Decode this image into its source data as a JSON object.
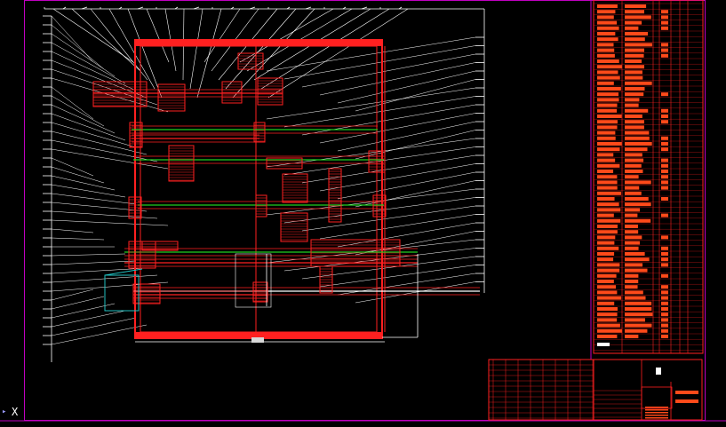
{
  "viewport": {
    "background": "#000000",
    "ucs_icon": {
      "name": "ucs-icon",
      "arrow_glyph": "▸",
      "axis_label": "X"
    }
  },
  "colors": {
    "frame": "#c000c0",
    "outline": "#ff2020",
    "hatch": "#ff2020",
    "leader": "#ffffff",
    "centerline": "#20d020",
    "cyan": "#20c0c0",
    "table_fill": "#ff4a1a",
    "table_grid": "#ff2020",
    "text_block": "#ffffff"
  }
}
